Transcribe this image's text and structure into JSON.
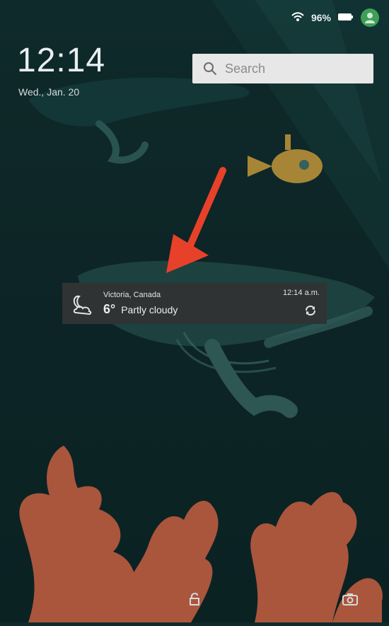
{
  "status": {
    "battery_text": "96%"
  },
  "clock": {
    "time": "12:14",
    "date": "Wed., Jan. 20"
  },
  "search": {
    "label": "Search"
  },
  "weather": {
    "location": "Victoria, Canada",
    "temperature": "6°",
    "condition": "Partly cloudy",
    "updated": "12:14 a.m."
  },
  "colors": {
    "background": "#0e2829",
    "accent": "#e8412a",
    "avatar": "#3f9f57",
    "coral": "#b05e43"
  }
}
